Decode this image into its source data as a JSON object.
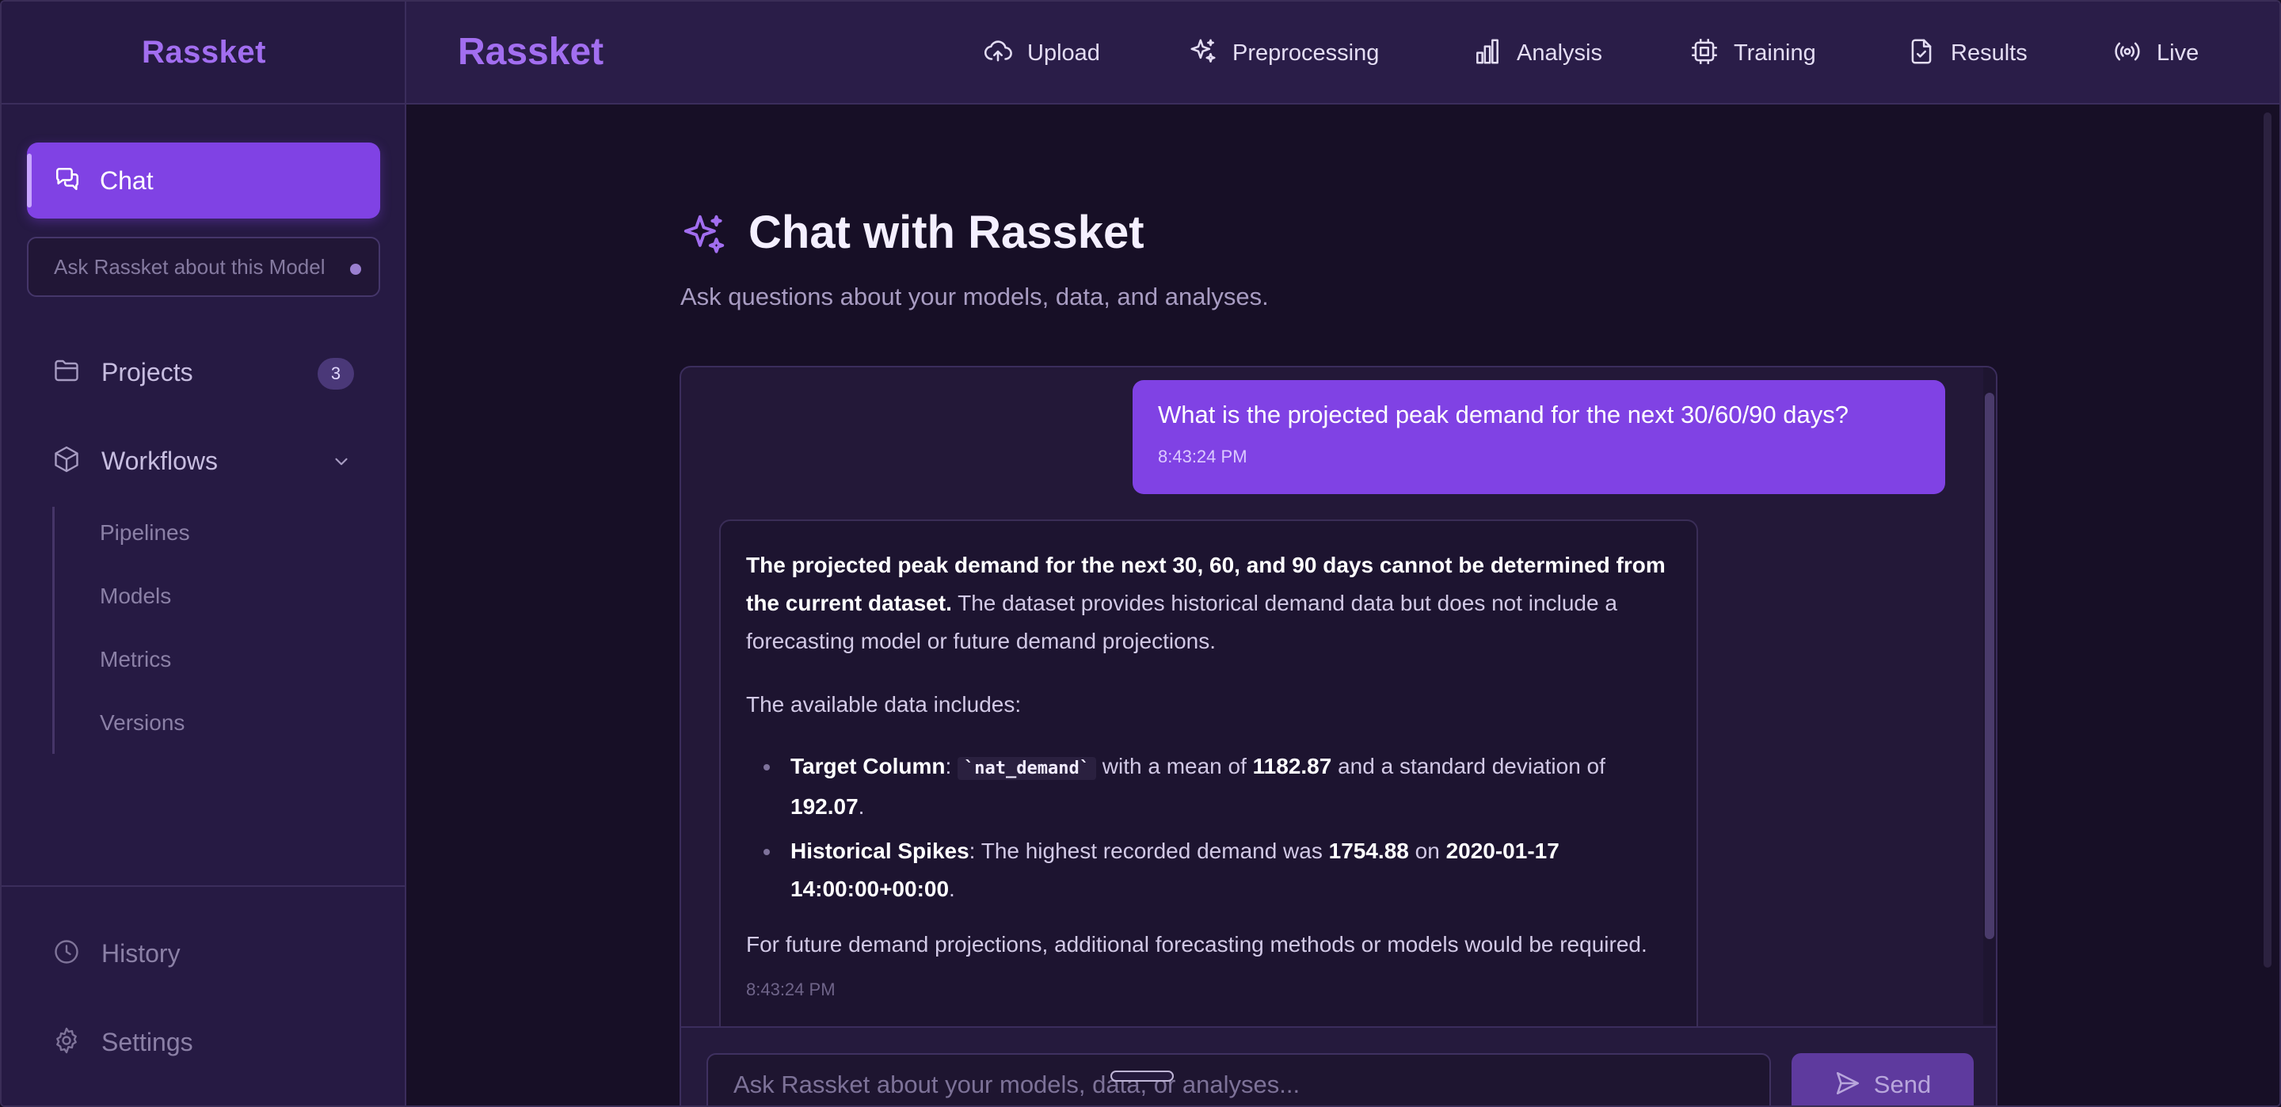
{
  "sidebar": {
    "brand": "Rassket",
    "chat_label": "Chat",
    "search_placeholder": "Ask Rassket about this Model",
    "projects_label": "Projects",
    "projects_count": "3",
    "workflows_label": "Workflows",
    "workflow_items": [
      "Pipelines",
      "Models",
      "Metrics",
      "Versions"
    ],
    "history_label": "History",
    "settings_label": "Settings"
  },
  "header": {
    "brand": "Rassket",
    "nav": [
      {
        "label": "Upload",
        "icon": "cloud-upload-icon"
      },
      {
        "label": "Preprocessing",
        "icon": "sparkles-icon"
      },
      {
        "label": "Analysis",
        "icon": "bar-chart-icon"
      },
      {
        "label": "Training",
        "icon": "cpu-icon"
      },
      {
        "label": "Results",
        "icon": "file-check-icon"
      },
      {
        "label": "Live",
        "icon": "broadcast-icon"
      }
    ]
  },
  "main": {
    "title": "Chat with Rassket",
    "subtitle": "Ask questions about your models, data, and analyses.",
    "user_message": {
      "text": "What is the projected peak demand for the next 30/60/90 days?",
      "time": "8:43:24 PM"
    },
    "bot_message": {
      "p1_bold": "The projected peak demand for the next 30, 60, and 90 days cannot be determined from the current dataset.",
      "p1_rest": " The dataset provides historical demand data but does not include a forecasting model or future demand projections.",
      "p2": "The available data includes:",
      "b1_label": "Target Column",
      "b1_sep": ": ",
      "b1_code": "`nat_demand`",
      "b1_t1": " with a mean of ",
      "b1_v1": "1182.87",
      "b1_t2": " and a standard deviation of ",
      "b1_v2": "192.07",
      "b1_t3": ".",
      "b2_label": "Historical Spikes",
      "b2_t1": ": The highest recorded demand was ",
      "b2_v1": "1754.88",
      "b2_t2": " on ",
      "b2_v2": "2020-01-17 14:00:00+00:00",
      "b2_t3": ".",
      "p3": "For future demand projections, additional forecasting methods or models would be required.",
      "time": "8:43:24 PM"
    },
    "input_placeholder": "Ask Rassket about your models, data, or analyses...",
    "send_label": "Send"
  },
  "colors": {
    "accent": "#8042e4",
    "brand": "#a26ef0",
    "sidebar_bg": "#261a43",
    "main_bg": "#170f26"
  }
}
